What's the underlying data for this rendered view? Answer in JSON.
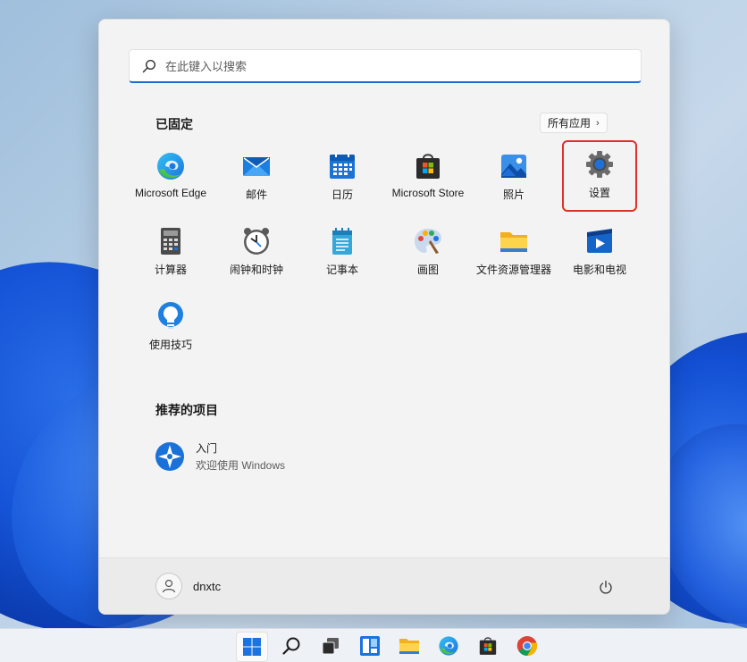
{
  "search": {
    "placeholder": "在此键入以搜索"
  },
  "pinned": {
    "title": "已固定",
    "all_apps_label": "所有应用",
    "apps": [
      {
        "label": "Microsoft Edge",
        "icon": "edge-icon"
      },
      {
        "label": "邮件",
        "icon": "mail-icon"
      },
      {
        "label": "日历",
        "icon": "calendar-icon"
      },
      {
        "label": "Microsoft Store",
        "icon": "store-icon"
      },
      {
        "label": "照片",
        "icon": "photos-icon"
      },
      {
        "label": "设置",
        "icon": "settings-gear-icon",
        "highlighted": true
      },
      {
        "label": "计算器",
        "icon": "calculator-icon"
      },
      {
        "label": "闹钟和时钟",
        "icon": "alarm-clock-icon"
      },
      {
        "label": "记事本",
        "icon": "notepad-icon"
      },
      {
        "label": "画图",
        "icon": "paint-palette-icon"
      },
      {
        "label": "文件资源管理器",
        "icon": "folder-icon"
      },
      {
        "label": "电影和电视",
        "icon": "movies-tv-icon"
      },
      {
        "label": "使用技巧",
        "icon": "tips-lightbulb-icon"
      }
    ]
  },
  "recommended": {
    "title": "推荐的项目",
    "items": [
      {
        "name": "入门",
        "subtitle": "欢迎使用 Windows",
        "icon": "get-started-icon"
      }
    ]
  },
  "footer": {
    "username": "dnxtc"
  },
  "taskbar": {
    "items": [
      "windows-start-icon",
      "search-icon",
      "task-view-icon",
      "widgets-icon",
      "file-explorer-icon",
      "edge-icon",
      "store-icon",
      "chrome-icon"
    ]
  },
  "colors": {
    "accent": "#1a6bcc",
    "highlight_border": "#e0302b"
  }
}
